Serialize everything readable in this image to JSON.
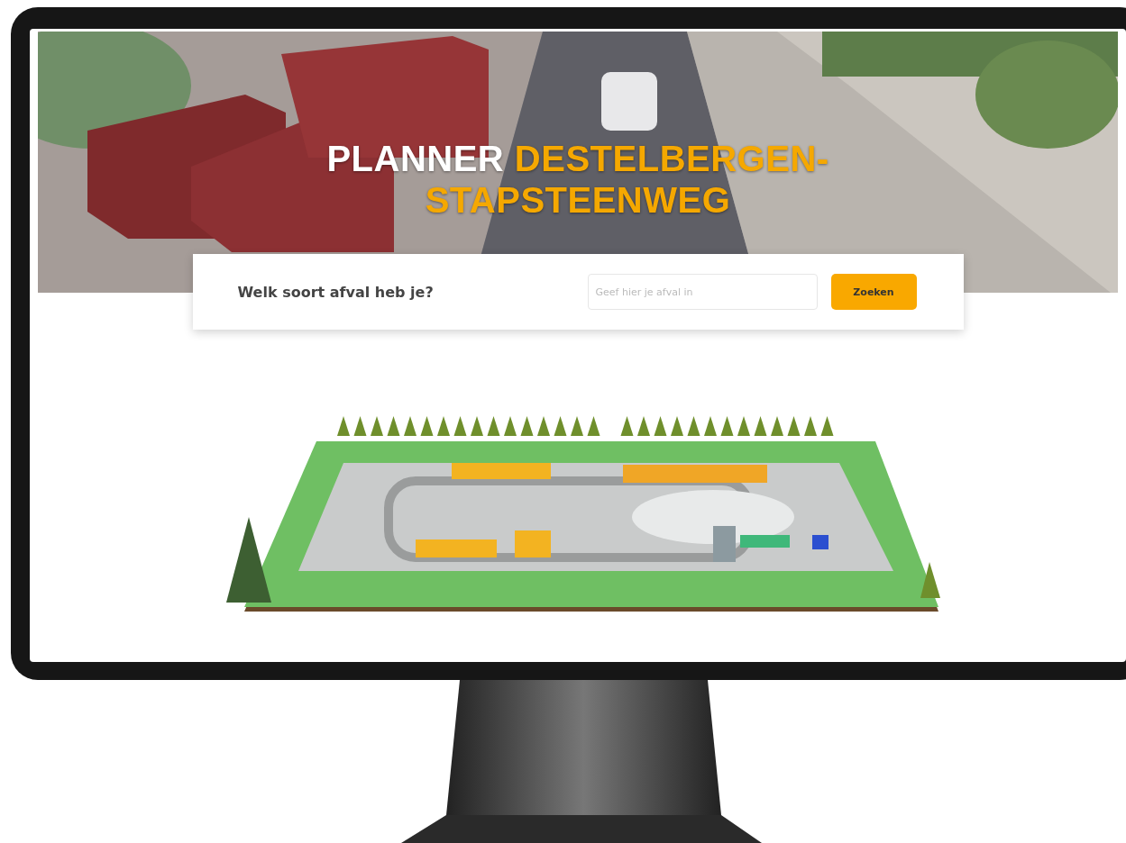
{
  "hero": {
    "kind": "picture",
    "title_prefix": "PLANNER",
    "title": "DESTELBERGEN-STAPSTEENWEG"
  },
  "search": {
    "label": "Welk soort afval heb je?",
    "placeholder": "Geef hier je afval in",
    "button": "Zoeken"
  }
}
